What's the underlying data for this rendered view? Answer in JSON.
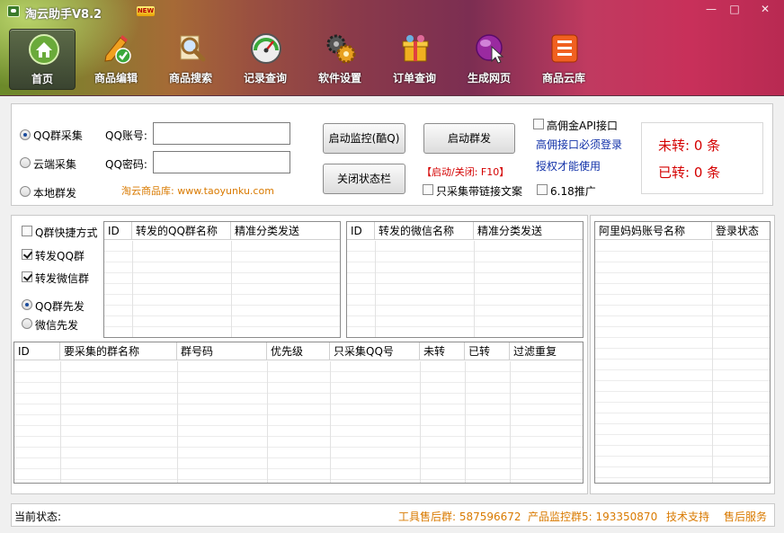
{
  "window": {
    "title": "淘云助手V8.2",
    "badge": "NEW",
    "minimize": "—",
    "maximize": "□",
    "close": "✕"
  },
  "toolbar": [
    {
      "label": "首页",
      "icon": "home-icon",
      "active": true
    },
    {
      "label": "商品编辑",
      "icon": "pencil-check-icon"
    },
    {
      "label": "商品搜索",
      "icon": "magnifier-icon"
    },
    {
      "label": "记录查询",
      "icon": "gauge-icon"
    },
    {
      "label": "软件设置",
      "icon": "gears-icon"
    },
    {
      "label": "订单查询",
      "icon": "gift-icon"
    },
    {
      "label": "生成网页",
      "icon": "globe-cursor-icon"
    },
    {
      "label": "商品云库",
      "icon": "cloud-db-icon"
    }
  ],
  "source": {
    "options": [
      "QQ群采集",
      "云端采集",
      "本地群发"
    ],
    "selected": 0
  },
  "login": {
    "qq_label": "QQ账号:",
    "qq_value": "",
    "pwd_label": "QQ密码:",
    "pwd_value": "",
    "link": "淘云商品库: www.taoyunku.com"
  },
  "buttons": {
    "start_monitor": "启动监控(酷Q)",
    "close_status": "关闭状态栏",
    "start_send": "启动群发",
    "hotkey": "【启动/关闭: F10】",
    "only_link_label": "只采集带链接文案"
  },
  "api": {
    "check_label": "高佣金API接口",
    "note1": "高佣接口必须登录",
    "note2": "授权才能使用",
    "promo_label": "6.18推广"
  },
  "counts": {
    "untransferred": "未转: 0 条",
    "transferred": "已转: 0 条"
  },
  "options": {
    "q_shortcut": "Q群快捷方式",
    "fwd_qq": "转发QQ群",
    "fwd_wechat": "转发微信群",
    "priority": [
      "QQ群先发",
      "微信先发"
    ],
    "priority_selected": 0
  },
  "grid_qq": {
    "columns": [
      "ID",
      "转发的QQ群名称",
      "精准分类发送"
    ]
  },
  "grid_wechat": {
    "columns": [
      "ID",
      "转发的微信名称",
      "精准分类发送"
    ]
  },
  "grid_alimama": {
    "columns": [
      "阿里妈妈账号名称",
      "登录状态"
    ]
  },
  "grid_collect": {
    "columns": [
      "ID",
      "要采集的群名称",
      "群号码",
      "优先级",
      "只采集QQ号",
      "未转",
      "已转",
      "过滤重复"
    ]
  },
  "status": {
    "label": "当前状态:",
    "support_group": "工具售后群: 587596672",
    "monitor_group": "产品监控群5: 193350870",
    "tech_support": "技术支持",
    "after_sales": "售后服务"
  }
}
